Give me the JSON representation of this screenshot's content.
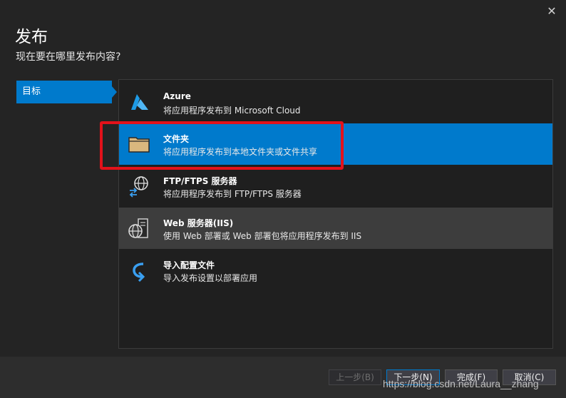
{
  "window": {
    "close_glyph": "✕"
  },
  "header": {
    "title": "发布",
    "subtitle": "现在要在哪里发布内容?"
  },
  "sidebar": {
    "items": [
      {
        "label": "目标",
        "selected": true
      }
    ]
  },
  "options": [
    {
      "name": "Azure",
      "description": "将应用程序发布到 Microsoft Cloud",
      "icon": "azure-icon",
      "selected": false
    },
    {
      "name": "文件夹",
      "description": "将应用程序发布到本地文件夹或文件共享",
      "icon": "folder-icon",
      "selected": true
    },
    {
      "name": "FTP/FTPS 服务器",
      "description": "将应用程序发布到 FTP/FTPS 服务器",
      "icon": "ftp-globe-icon",
      "selected": false
    },
    {
      "name": "Web 服务器(IIS)",
      "description": "使用 Web 部署或 Web 部署包将应用程序发布到 IIS",
      "icon": "web-server-icon",
      "selected": false
    },
    {
      "name": "导入配置文件",
      "description": "导入发布设置以部署应用",
      "icon": "import-icon",
      "selected": false
    }
  ],
  "footer": {
    "prev_label": "上一步(B)",
    "next_label": "下一步(N)",
    "finish_label": "完成(F)",
    "cancel_label": "取消(C)"
  },
  "watermark": "https://blog.csdn.net/Laura__zhang",
  "colors": {
    "accent": "#007acc",
    "highlight": "#e3121a",
    "background": "#242424"
  }
}
